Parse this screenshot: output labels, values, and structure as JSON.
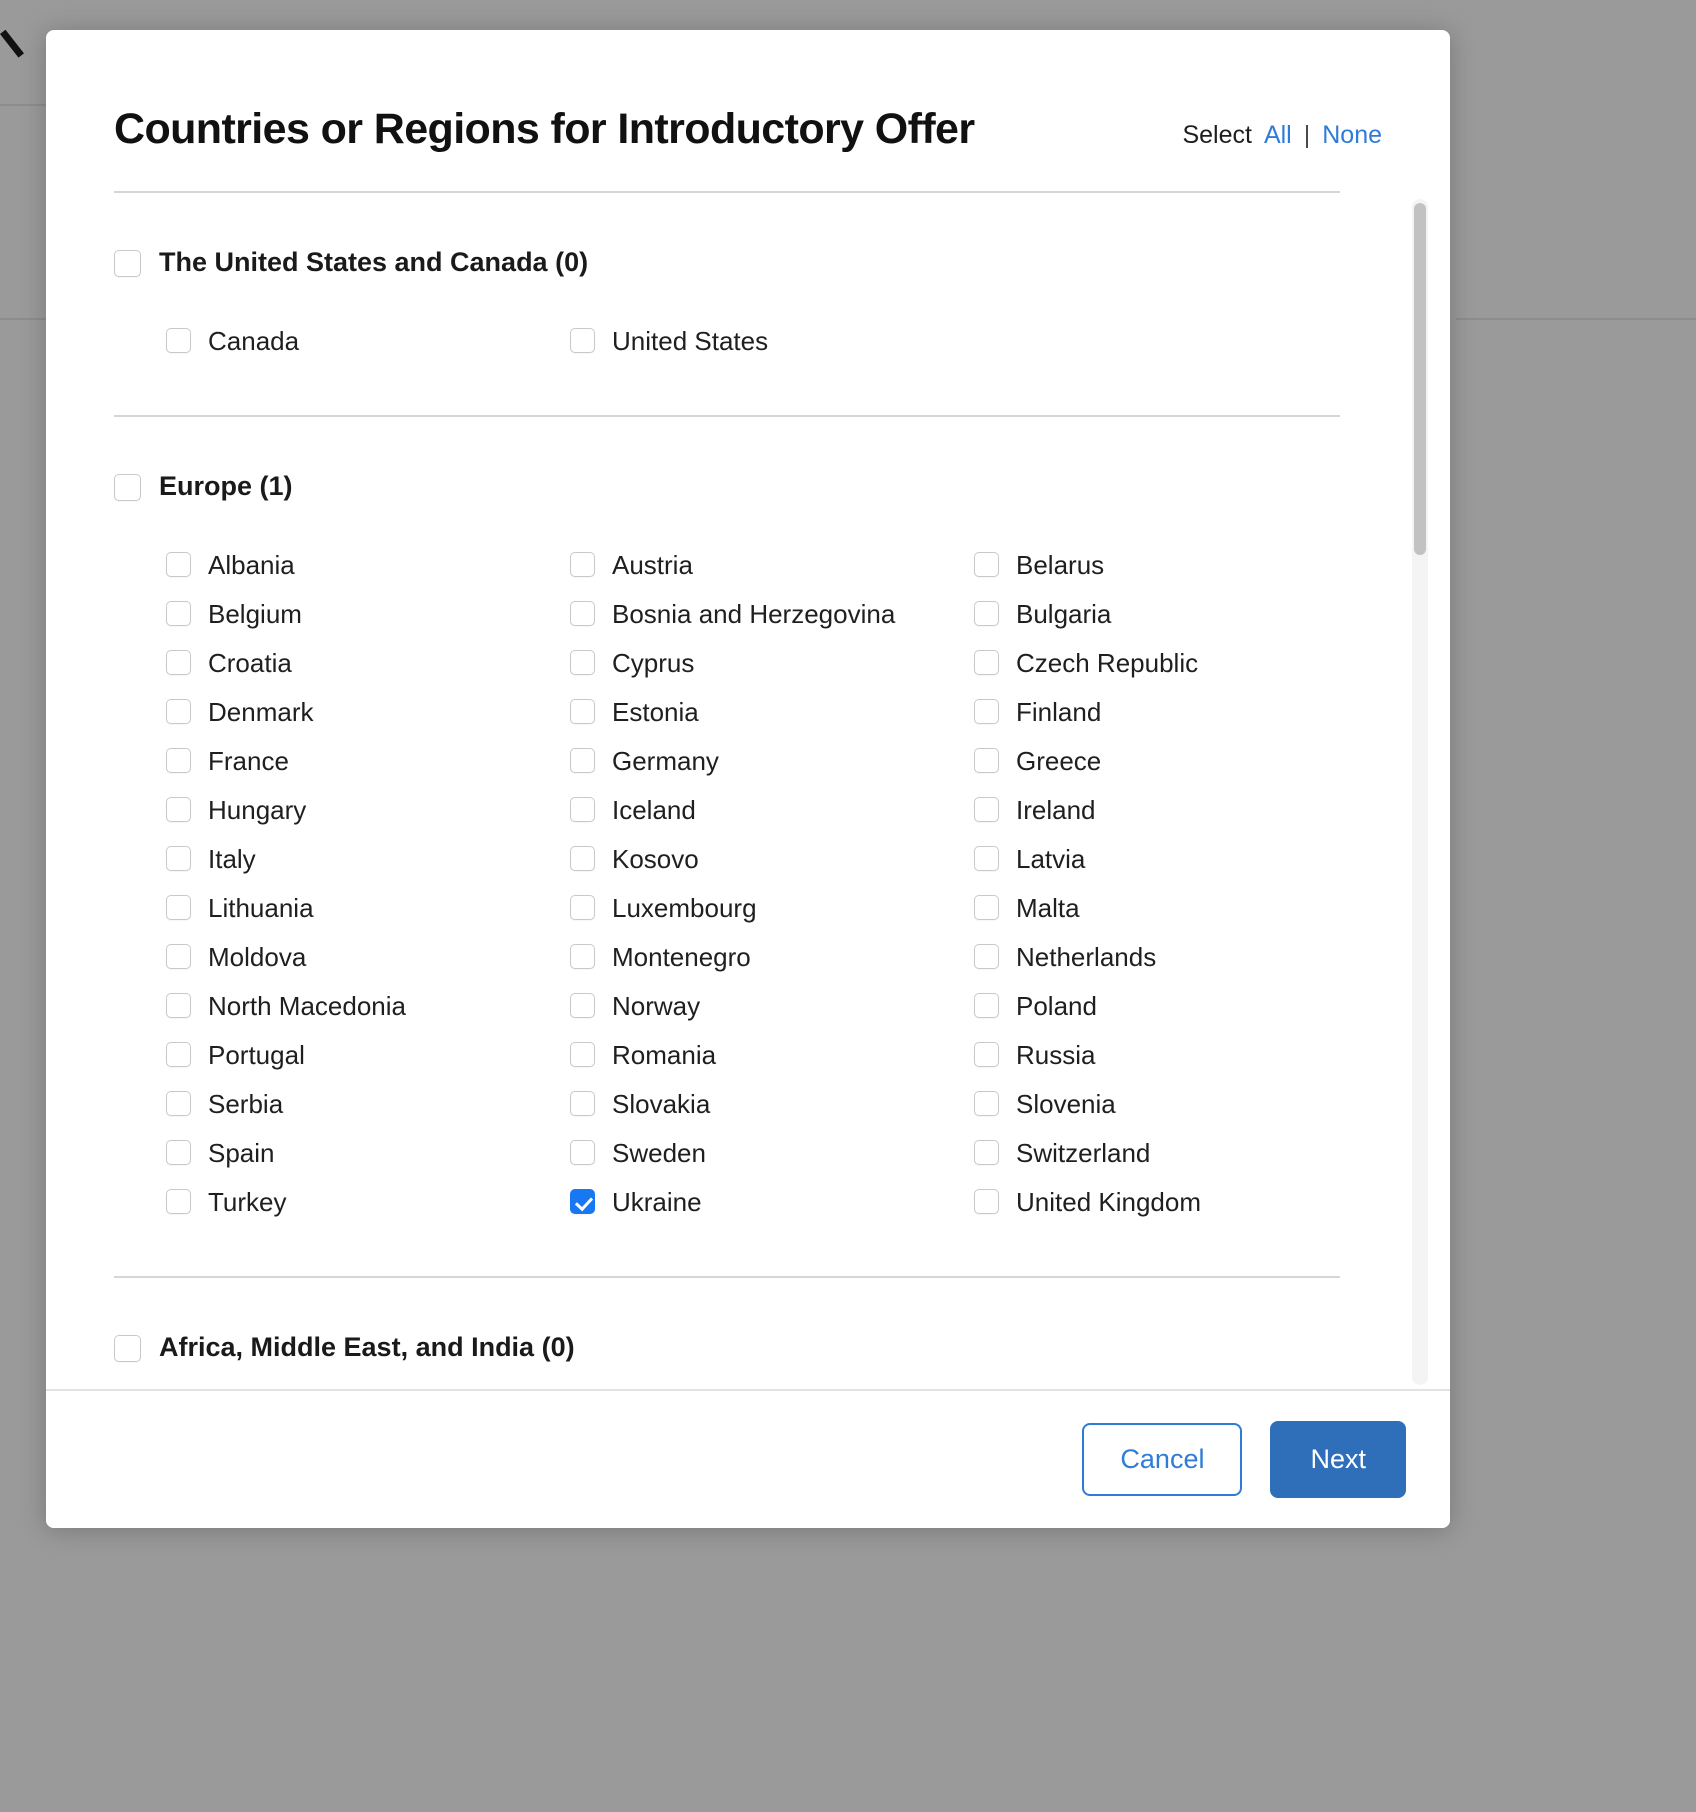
{
  "dialog": {
    "title": "Countries or Regions for Introductory Offer",
    "select_label": "Select",
    "select_all": "All",
    "separator": "|",
    "select_none": "None"
  },
  "sections": [
    {
      "name": "united-states-and-canada",
      "label": "The United States and Canada (0)",
      "checked": false,
      "count": 0,
      "countries": [
        {
          "label": "Canada",
          "checked": false
        },
        {
          "label": "United States",
          "checked": false
        }
      ]
    },
    {
      "name": "europe",
      "label": "Europe (1)",
      "checked": false,
      "count": 1,
      "countries": [
        {
          "label": "Albania",
          "checked": false
        },
        {
          "label": "Austria",
          "checked": false
        },
        {
          "label": "Belarus",
          "checked": false
        },
        {
          "label": "Belgium",
          "checked": false
        },
        {
          "label": "Bosnia and Herzegovina",
          "checked": false
        },
        {
          "label": "Bulgaria",
          "checked": false
        },
        {
          "label": "Croatia",
          "checked": false
        },
        {
          "label": "Cyprus",
          "checked": false
        },
        {
          "label": "Czech Republic",
          "checked": false
        },
        {
          "label": "Denmark",
          "checked": false
        },
        {
          "label": "Estonia",
          "checked": false
        },
        {
          "label": "Finland",
          "checked": false
        },
        {
          "label": "France",
          "checked": false
        },
        {
          "label": "Germany",
          "checked": false
        },
        {
          "label": "Greece",
          "checked": false
        },
        {
          "label": "Hungary",
          "checked": false
        },
        {
          "label": "Iceland",
          "checked": false
        },
        {
          "label": "Ireland",
          "checked": false
        },
        {
          "label": "Italy",
          "checked": false
        },
        {
          "label": "Kosovo",
          "checked": false
        },
        {
          "label": "Latvia",
          "checked": false
        },
        {
          "label": "Lithuania",
          "checked": false
        },
        {
          "label": "Luxembourg",
          "checked": false
        },
        {
          "label": "Malta",
          "checked": false
        },
        {
          "label": "Moldova",
          "checked": false
        },
        {
          "label": "Montenegro",
          "checked": false
        },
        {
          "label": "Netherlands",
          "checked": false
        },
        {
          "label": "North Macedonia",
          "checked": false
        },
        {
          "label": "Norway",
          "checked": false
        },
        {
          "label": "Poland",
          "checked": false
        },
        {
          "label": "Portugal",
          "checked": false
        },
        {
          "label": "Romania",
          "checked": false
        },
        {
          "label": "Russia",
          "checked": false
        },
        {
          "label": "Serbia",
          "checked": false
        },
        {
          "label": "Slovakia",
          "checked": false
        },
        {
          "label": "Slovenia",
          "checked": false
        },
        {
          "label": "Spain",
          "checked": false
        },
        {
          "label": "Sweden",
          "checked": false
        },
        {
          "label": "Switzerland",
          "checked": false
        },
        {
          "label": "Turkey",
          "checked": false
        },
        {
          "label": "Ukraine",
          "checked": true
        },
        {
          "label": "United Kingdom",
          "checked": false
        }
      ]
    },
    {
      "name": "africa-middle-east-india",
      "label": "Africa, Middle East, and India (0)",
      "checked": false,
      "count": 0,
      "countries": []
    }
  ],
  "footer": {
    "cancel_label": "Cancel",
    "next_label": "Next"
  },
  "colors": {
    "accent_blue": "#1877f2",
    "link_blue": "#2f7cd6",
    "primary_button": "#2f6fba",
    "backdrop": "#9a9a9a"
  }
}
